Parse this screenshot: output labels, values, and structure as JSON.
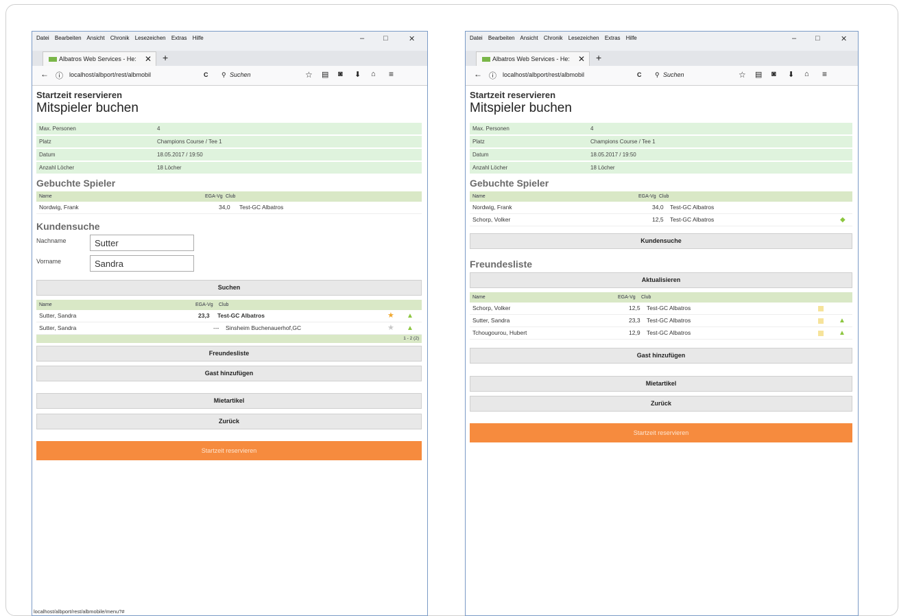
{
  "menu": [
    "Datei",
    "Bearbeiten",
    "Ansicht",
    "Chronik",
    "Lesezeichen",
    "Extras",
    "Hilfe"
  ],
  "window_controls": {
    "minimize": "–",
    "maximize": "□",
    "close": "✕"
  },
  "tab": {
    "title": "Albatros Web Services - He:",
    "close": "✕",
    "new": "+"
  },
  "nav": {
    "back": "←",
    "info": "ⓘ",
    "url": "localhost/albport/rest/albmobil",
    "reload": "C",
    "search_placeholder": "Suchen",
    "icons": [
      "star-icon",
      "reading-list-icon",
      "pocket-icon",
      "download-icon",
      "home-icon",
      "menu-icon"
    ]
  },
  "heading": {
    "sub": "Startzeit reservieren",
    "main": "Mitspieler buchen"
  },
  "info": [
    {
      "key": "Max. Personen",
      "value": "4"
    },
    {
      "key": "Platz",
      "value": "Champions Course / Tee 1"
    },
    {
      "key": "Datum",
      "value": "18.05.2017 / 19:50"
    },
    {
      "key": "Anzahl Löcher",
      "value": "18 Löcher"
    }
  ],
  "players_title": "Gebuchte Spieler",
  "columns": {
    "name": "Name",
    "ega": "EGA-Vg",
    "club": "Club"
  },
  "left": {
    "players": [
      {
        "name": "Nordwig, Frank",
        "ega": "34,0",
        "club": "Test-GC Albatros"
      }
    ],
    "search_title": "Kundensuche",
    "fields": [
      {
        "label": "Nachname",
        "value": "Sutter"
      },
      {
        "label": "Vorname",
        "value": "Sandra"
      }
    ],
    "search_button": "Suchen",
    "results": [
      {
        "name": "Sutter, Sandra",
        "ega": "23,3",
        "club": "Test-GC Albatros"
      },
      {
        "name": "Sutter, Sandra",
        "ega": "---",
        "club": "Sinsheim Buchenauerhof,GC"
      }
    ],
    "pager": "1 - 2 (2)",
    "buttons": [
      "Freundesliste",
      "Gast hinzufügen",
      "Mietartikel",
      "Zurück"
    ],
    "reserve": "Startzeit reservieren",
    "status_url": "localhost/albport/rest/albmobile/menu?#"
  },
  "right": {
    "players": [
      {
        "name": "Nordwig, Frank",
        "ega": "34,0",
        "club": "Test-GC Albatros"
      },
      {
        "name": "Schorp, Volker",
        "ega": "12,5",
        "club": "Test-GC Albatros"
      }
    ],
    "kundensuche_button": "Kundensuche",
    "friends_title": "Freundesliste",
    "refresh_button": "Aktualisieren",
    "friends": [
      {
        "name": "Schorp, Volker",
        "ega": "12,5",
        "club": "Test-GC Albatros"
      },
      {
        "name": "Sutter, Sandra",
        "ega": "23,3",
        "club": "Test-GC Albatros"
      },
      {
        "name": "Tchougourou, Hubert",
        "ega": "12,9",
        "club": "Test-GC Albatros"
      }
    ],
    "buttons": [
      "Gast hinzufügen",
      "Mietartikel",
      "Zurück"
    ],
    "reserve": "Startzeit reservieren"
  }
}
